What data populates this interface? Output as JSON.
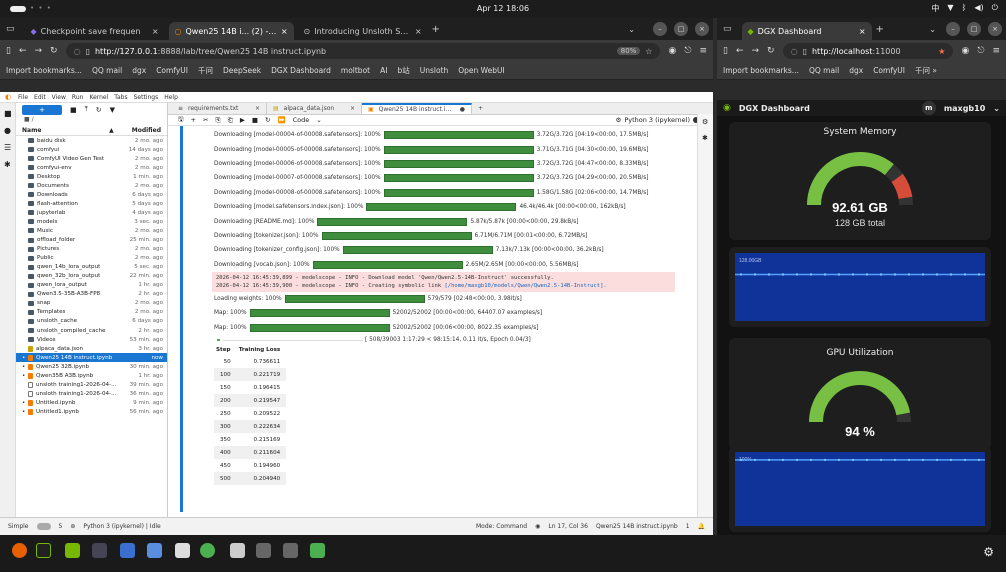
{
  "system": {
    "clock": "Apr 12  18:06"
  },
  "left_browser": {
    "tabs": [
      {
        "label": "Checkpoint save frequen",
        "active": false
      },
      {
        "label": "Qwen25 14B i... (2) - Jupy",
        "active": true
      },
      {
        "label": "Introducing Unsloth Stud",
        "active": false
      }
    ],
    "url_host": "http://127.0.0.1",
    "url_rest": ":8888/lab/tree/Qwen25 14B instruct.ipynb",
    "zoom": "80%",
    "bookmarks": [
      "Import bookmarks...",
      "QQ mail",
      "dgx",
      "ComfyUI",
      "千问",
      "DeepSeek",
      "DGX Dashboard",
      "moltbot",
      "AI",
      "b站",
      "Unsloth",
      "Open WebUI"
    ]
  },
  "right_browser": {
    "tab": "DGX Dashboard",
    "url_host": "http://localhost",
    "url_rest": ":11000",
    "bookmarks": [
      "Import bookmarks...",
      "QQ mail",
      "dgx",
      "ComfyUI",
      "千问 »"
    ]
  },
  "jupyter": {
    "menu": [
      "File",
      "Edit",
      "View",
      "Run",
      "Kernel",
      "Tabs",
      "Settings",
      "Help"
    ],
    "breadcrumb": "■ /",
    "fb_headers": {
      "name": "Name",
      "modified": "Modified"
    },
    "files": [
      {
        "name": "baidu disk",
        "modified": "2 mo. ago",
        "type": "folder",
        "dot": false
      },
      {
        "name": "comfyui",
        "modified": "14 days ago",
        "type": "folder",
        "dot": false
      },
      {
        "name": "ComfyUI Video Gen Test",
        "modified": "2 mo. ago",
        "type": "folder",
        "dot": false
      },
      {
        "name": "comfyui-env",
        "modified": "2 mo. ago",
        "type": "folder",
        "dot": false
      },
      {
        "name": "Desktop",
        "modified": "1 min. ago",
        "type": "folder",
        "dot": false
      },
      {
        "name": "Documents",
        "modified": "2 mo. ago",
        "type": "folder",
        "dot": false
      },
      {
        "name": "Downloads",
        "modified": "6 days ago",
        "type": "folder",
        "dot": false
      },
      {
        "name": "flash-attention",
        "modified": "5 days ago",
        "type": "folder",
        "dot": false
      },
      {
        "name": "jupyterlab",
        "modified": "4 days ago",
        "type": "folder",
        "dot": false
      },
      {
        "name": "models",
        "modified": "3 sec. ago",
        "type": "folder",
        "dot": false
      },
      {
        "name": "Music",
        "modified": "2 mo. ago",
        "type": "folder",
        "dot": false
      },
      {
        "name": "offload_folder",
        "modified": "25 min. ago",
        "type": "folder",
        "dot": false
      },
      {
        "name": "Pictures",
        "modified": "2 mo. ago",
        "type": "folder",
        "dot": false
      },
      {
        "name": "Public",
        "modified": "2 mo. ago",
        "type": "folder",
        "dot": false
      },
      {
        "name": "qwen_14b_lora_output",
        "modified": "5 sec. ago",
        "type": "folder",
        "dot": false
      },
      {
        "name": "qwen_32b_lora_output",
        "modified": "22 min. ago",
        "type": "folder",
        "dot": false
      },
      {
        "name": "qwen_lora_output",
        "modified": "1 hr. ago",
        "type": "folder",
        "dot": false
      },
      {
        "name": "Qwen3.5-35B-A3B-FP8",
        "modified": "2 hr. ago",
        "type": "folder",
        "dot": false
      },
      {
        "name": "snap",
        "modified": "2 mo. ago",
        "type": "folder",
        "dot": false
      },
      {
        "name": "Templates",
        "modified": "2 mo. ago",
        "type": "folder",
        "dot": false
      },
      {
        "name": "unsloth_cache",
        "modified": "6 days ago",
        "type": "folder",
        "dot": false
      },
      {
        "name": "unsloth_compiled_cache",
        "modified": "2 hr. ago",
        "type": "folder",
        "dot": false
      },
      {
        "name": "Videos",
        "modified": "53 min. ago",
        "type": "folder",
        "dot": false
      },
      {
        "name": "alpaca_data.json",
        "modified": "3 hr. ago",
        "type": "json",
        "dot": false
      },
      {
        "name": "Qwen25 14B instruct.ipynb",
        "modified": "now",
        "type": "nb",
        "dot": true,
        "selected": true
      },
      {
        "name": "Qwen25 32B.ipynb",
        "modified": "30 min. ago",
        "type": "nb",
        "dot": true
      },
      {
        "name": "Qwen35B A3B.ipynb",
        "modified": "1 hr. ago",
        "type": "nb",
        "dot": true
      },
      {
        "name": "unsloth training1-2026-04-...",
        "modified": "39 min. ago",
        "type": "file",
        "dot": false
      },
      {
        "name": "unsloth training1-2026-04-...",
        "modified": "36 min. ago",
        "type": "file",
        "dot": false
      },
      {
        "name": "Untitled.ipynb",
        "modified": "9 min. ago",
        "type": "nb",
        "dot": true
      },
      {
        "name": "Untitled1.ipynb",
        "modified": "56 min. ago",
        "type": "nb",
        "dot": true
      }
    ],
    "doc_tabs": [
      {
        "label": "requirements.txt",
        "active": false
      },
      {
        "label": "alpaca_data.json",
        "active": false
      },
      {
        "label": "Qwen25 14B instruct.ipynb",
        "active": true
      }
    ],
    "cell_type": "Code",
    "kernel": "Python 3 (ipykernel)",
    "progress": [
      {
        "label": "Downloading [model-00004-of-00008.safetensors]: 100%",
        "stats": "3.72G/3.72G [04:19<00:00, 17.5MB/s]",
        "frac": 1.0
      },
      {
        "label": "Downloading [model-00005-of-00008.safetensors]: 100%",
        "stats": "3.71G/3.71G [04:30<00:00, 19.6MB/s]",
        "frac": 1.0
      },
      {
        "label": "Downloading [model-00006-of-00008.safetensors]: 100%",
        "stats": "3.72G/3.72G [04:47<00:00, 8.33MB/s]",
        "frac": 1.0
      },
      {
        "label": "Downloading [model-00007-of-00008.safetensors]: 100%",
        "stats": "3.72G/3.72G [04:29<00:00, 20.5MB/s]",
        "frac": 1.0
      },
      {
        "label": "Downloading [model-00008-of-00008.safetensors]: 100%",
        "stats": "1.58G/1.58G [02:06<00:00, 14.7MB/s]",
        "frac": 1.0
      },
      {
        "label": "Downloading [model.safetensors.index.json]: 100%",
        "stats": "46.4k/46.4k [00:00<00:00, 162kB/s]",
        "frac": 1.0
      },
      {
        "label": "Downloading [README.md]: 100%",
        "stats": "5.87k/5.87k [00:00<00:00, 29.8kB/s]",
        "frac": 1.0
      },
      {
        "label": "Downloading [tokenizer.json]: 100%",
        "stats": "6.71M/6.71M [00:01<00:00, 6.72MB/s]",
        "frac": 1.0
      },
      {
        "label": "Downloading [tokenizer_config.json]: 100%",
        "stats": "7.13k/7.13k [00:00<00:00, 36.2kB/s]",
        "frac": 1.0
      },
      {
        "label": "Downloading [vocab.json]: 100%",
        "stats": "2.65M/2.65M [00:00<00:00, 5.56MB/s]",
        "frac": 1.0
      }
    ],
    "log_lines": [
      {
        "text": "2026-04-12 16:45:39,899 - modelscope - INFO - Download model 'Qwen/Qwen2.5-14B-Instruct' successfully.",
        "link": ""
      },
      {
        "text": "2026-04-12 16:45:39,900 - modelscope - INFO - Creating symbolic link ",
        "link": "[/home/maxgb10/models/Qwen/Qwen2.5-14B-Instruct]."
      }
    ],
    "progress2": [
      {
        "label": "Loading weights: 100%",
        "stats": "579/579 [02:48<00:00,  3.98it/s]",
        "frac": 1.0
      },
      {
        "label": "Map: 100%",
        "stats": "52002/52002 [00:00<00:00, 64407.07 examples/s]",
        "frac": 1.0
      },
      {
        "label": "Map: 100%",
        "stats": "52002/52002 [00:06<00:00, 8022.35 examples/s]",
        "frac": 1.0
      }
    ],
    "training_progress": {
      "text": "[ 508/39003 1:17:29 < 98:15:14, 0.11 it/s, Epoch 0.04/3]",
      "frac": 0.013
    },
    "loss_headers": {
      "step": "Step",
      "loss": "Training Loss"
    },
    "loss_rows": [
      {
        "step": "50",
        "loss": "0.736611"
      },
      {
        "step": "100",
        "loss": "0.221719"
      },
      {
        "step": "150",
        "loss": "0.196415"
      },
      {
        "step": "200",
        "loss": "0.219547"
      },
      {
        "step": "250",
        "loss": "0.209522"
      },
      {
        "step": "300",
        "loss": "0.222634"
      },
      {
        "step": "350",
        "loss": "0.215169"
      },
      {
        "step": "400",
        "loss": "0.211604"
      },
      {
        "step": "450",
        "loss": "0.194960"
      },
      {
        "step": "500",
        "loss": "0.204940"
      }
    ],
    "empty_cell_prompt": "[ ]:",
    "status": {
      "mode": "Simple",
      "count": "5",
      "kernel": "Python 3 (ipykernel) | Idle",
      "command": "Mode: Command",
      "position": "Ln 17, Col 36",
      "file": "Qwen25 14B instruct.ipynb",
      "num": "1"
    }
  },
  "dgx": {
    "title": "DGX Dashboard",
    "user_initial": "m",
    "user": "maxgb10",
    "memory": {
      "title": "System Memory",
      "value": "92.61 GB",
      "total": "128 GB total",
      "frac": 0.72
    },
    "memory_plot": {
      "label": "128.00GB",
      "level": 0.72
    },
    "gpu": {
      "title": "GPU Utilization",
      "value": "94 %",
      "frac": 0.94
    },
    "gpu_plot": {
      "label": "100%",
      "level": 0.94
    }
  }
}
